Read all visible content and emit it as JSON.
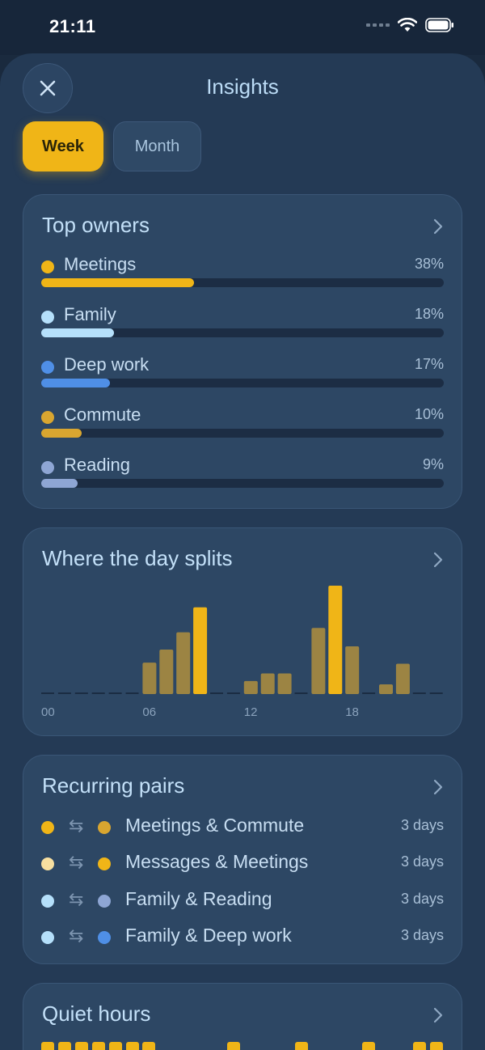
{
  "status_bar": {
    "time": "21:11"
  },
  "header": {
    "title": "Insights",
    "close_icon": "close-icon"
  },
  "segments": {
    "week_label": "Week",
    "month_label": "Month",
    "selected": "Week"
  },
  "top_owners": {
    "title": "Top owners",
    "items": [
      {
        "label": "Meetings",
        "pct": "38%",
        "value": 0.38,
        "color": "#f0b517"
      },
      {
        "label": "Family",
        "pct": "18%",
        "value": 0.18,
        "color": "#b5e0fb"
      },
      {
        "label": "Deep work",
        "pct": "17%",
        "value": 0.17,
        "color": "#4f8fe6"
      },
      {
        "label": "Commute",
        "pct": "10%",
        "value": 0.1,
        "color": "#d9a630"
      },
      {
        "label": "Reading",
        "pct": "9%",
        "value": 0.09,
        "color": "#8ea6d4"
      }
    ]
  },
  "day_split": {
    "title": "Where the day splits",
    "tick_labels": [
      "00",
      "06",
      "12",
      "18"
    ]
  },
  "chart_data": {
    "type": "bar",
    "title": "Where the day splits",
    "categories": [
      "00",
      "01",
      "02",
      "03",
      "04",
      "05",
      "06",
      "07",
      "08",
      "09",
      "10",
      "11",
      "12",
      "13",
      "14",
      "15",
      "16",
      "17",
      "18",
      "19",
      "20",
      "21",
      "22",
      "23"
    ],
    "values": [
      0,
      0,
      0,
      0,
      0,
      0,
      0.29,
      0.41,
      0.57,
      0.8,
      0,
      0,
      0.12,
      0.19,
      0.19,
      0,
      0.61,
      1.0,
      0.44,
      0,
      0.09,
      0.28,
      0,
      0
    ],
    "highlight": [
      9,
      17
    ],
    "xticks": [
      "00",
      "06",
      "12",
      "18"
    ],
    "grid": false,
    "colors": {
      "bar": "#9c8443",
      "highlight": "#f0b517",
      "empty": "#1b2c42"
    }
  },
  "recurring_pairs": {
    "title": "Recurring pairs",
    "items": [
      {
        "label": "Meetings & Commute",
        "days": "3 days",
        "color_a": "#f0b517",
        "color_b": "#d9a630"
      },
      {
        "label": "Messages & Meetings",
        "days": "3 days",
        "color_a": "#f7dfa0",
        "color_b": "#f0b517"
      },
      {
        "label": "Family & Reading",
        "days": "3 days",
        "color_a": "#b5e0fb",
        "color_b": "#8ea6d4"
      },
      {
        "label": "Family & Deep work",
        "days": "3 days",
        "color_a": "#b5e0fb",
        "color_b": "#4f8fe6"
      }
    ]
  },
  "quiet_hours": {
    "title": "Quiet hours",
    "slots": [
      0,
      1,
      2,
      3,
      4,
      5,
      6,
      11,
      15,
      19,
      22,
      23
    ]
  }
}
